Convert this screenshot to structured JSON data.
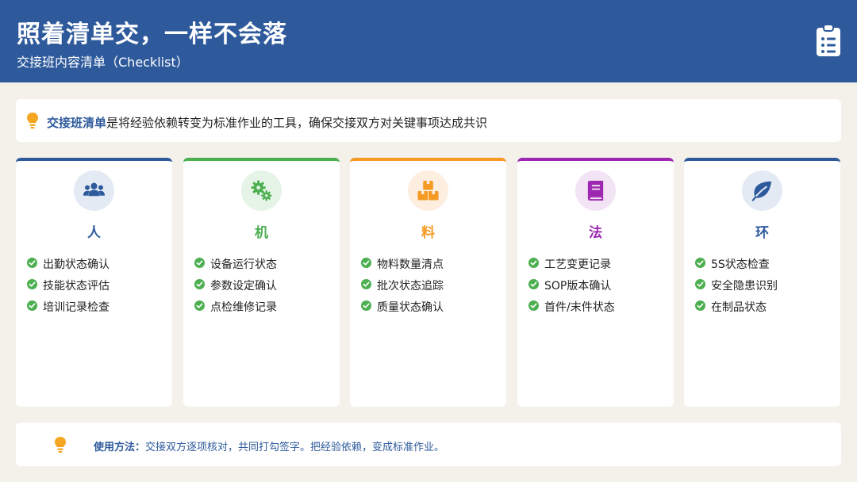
{
  "header": {
    "title": "照着清单交，一样不会落",
    "subtitle": "交接班内容清单（Checklist）",
    "icon": "clipboard-list-icon"
  },
  "intro": {
    "icon": "lightbulb-icon",
    "highlight": "交接班清单",
    "text": "是将经验依赖转变为标准作业的工具，确保交接双方对关键事项达成共识"
  },
  "cards": [
    {
      "title": "人",
      "icon": "users-icon",
      "color": "#2e5a9c",
      "bg": "#e4eaf4",
      "items": [
        "出勤状态确认",
        "技能状态评估",
        "培训记录检查"
      ]
    },
    {
      "title": "机",
      "icon": "gears-icon",
      "color": "#4caf50",
      "bg": "#e5f4e6",
      "items": [
        "设备运行状态",
        "参数设定确认",
        "点检维修记录"
      ]
    },
    {
      "title": "料",
      "icon": "boxes-icon",
      "color": "#f59a23",
      "bg": "#fdeee0",
      "items": [
        "物料数量清点",
        "批次状态追踪",
        "质量状态确认"
      ]
    },
    {
      "title": "法",
      "icon": "book-icon",
      "color": "#9c27b0",
      "bg": "#f3e4f5",
      "items": [
        "工艺变更记录",
        "SOP版本确认",
        "首件/末件状态"
      ]
    },
    {
      "title": "环",
      "icon": "leaf-icon",
      "color": "#2e5a9c",
      "bg": "#e4eaf4",
      "items": [
        "5S状态检查",
        "安全隐患识别",
        "在制品状态"
      ]
    }
  ],
  "usage": {
    "icon": "lightbulb-icon",
    "label": "使用方法：",
    "text": "交接双方逐项核对，共同打勾签字。把经验依赖，变成标准作业。"
  },
  "colors": {
    "primary": "#2e5a9c",
    "check": "#4caf50",
    "bulb": "#f5a623",
    "background": "#f3f1ea"
  }
}
